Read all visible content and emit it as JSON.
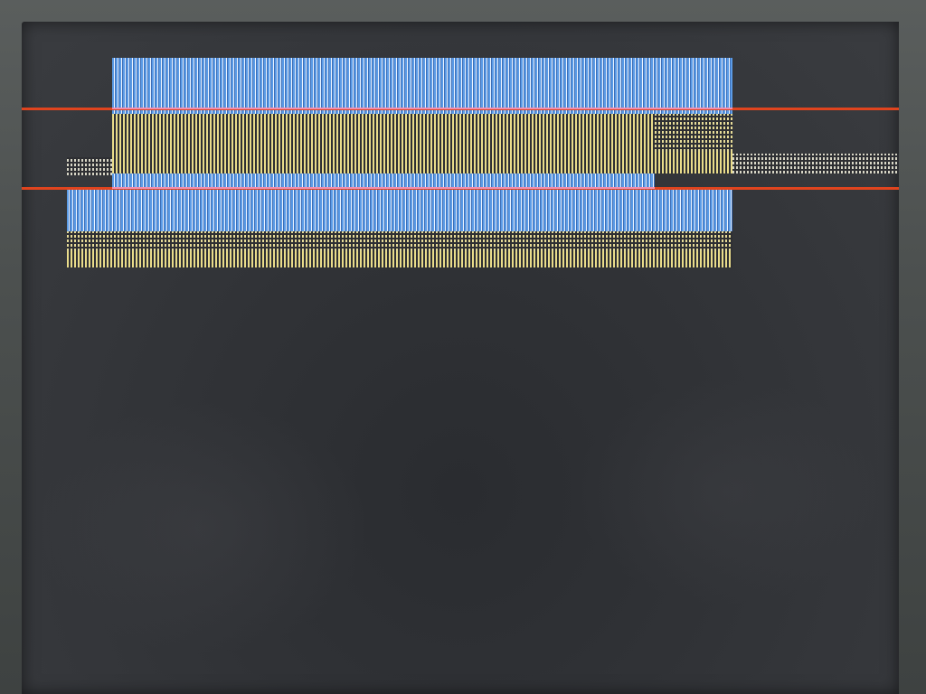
{
  "display": {
    "colors": {
      "background": "#303236",
      "blue": "#5b9be6",
      "yellow": "#e9dc8a",
      "red_line": "#e0441e",
      "pink_line": "#f08fb0"
    }
  }
}
